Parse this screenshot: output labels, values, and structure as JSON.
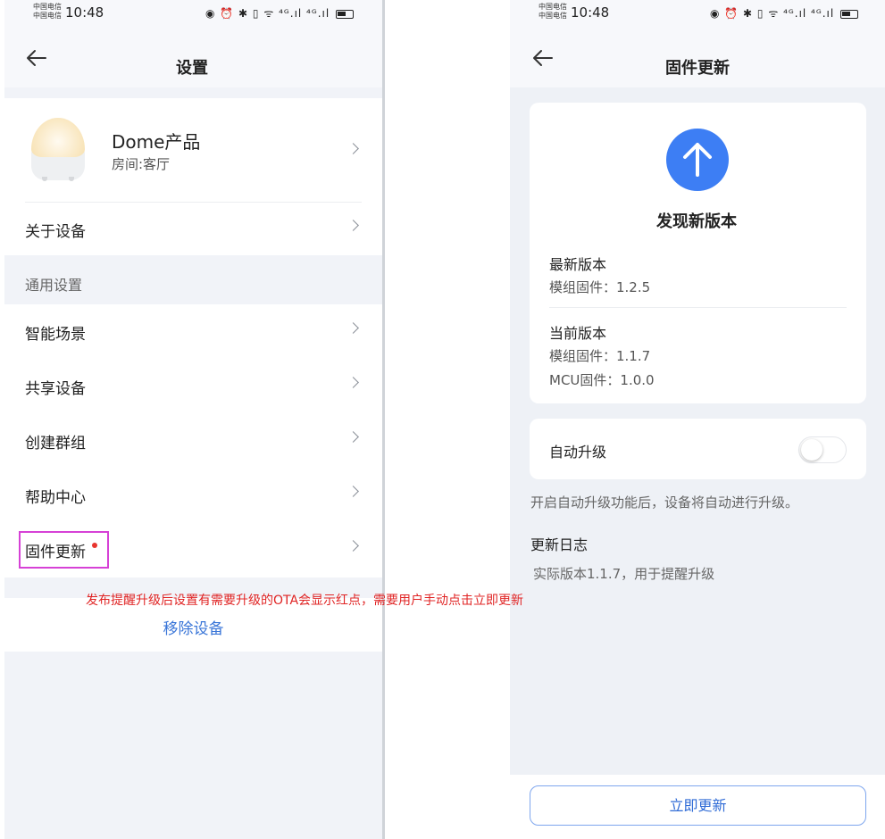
{
  "left": {
    "status": {
      "carrier1": "中国电信",
      "carrier2": "中国电信",
      "time": "10:48",
      "icons": "◉ ⏰ ✱ ▯ ᯤ ⁴ᴳ.ıl ⁴ᴳ.ıl"
    },
    "title": "设置",
    "device": {
      "name": "Dome产品",
      "room": "房间:客厅"
    },
    "about_label": "关于设备",
    "section_general": "通用设置",
    "items": [
      {
        "label": "智能场景"
      },
      {
        "label": "共享设备"
      },
      {
        "label": "创建群组"
      },
      {
        "label": "帮助中心"
      },
      {
        "label": "固件更新"
      }
    ],
    "remove_label": "移除设备",
    "annotation": "发布提醒升级后设置有需要升级的OTA会显示红点，需要用户手动点击立即更新",
    "accent": "#3a76d8",
    "highlight_color": "#d641d6",
    "annotation_color": "#e02424"
  },
  "right": {
    "status": {
      "carrier1": "中国电信",
      "carrier2": "中国电信",
      "time": "10:48",
      "icons": "◉ ⏰ ✱ ▯ ᯤ ⁴ᴳ.ıl ⁴ᴳ.ıl"
    },
    "title": "固件更新",
    "found_new": "发现新版本",
    "latest_heading": "最新版本",
    "latest_module": "模组固件：1.2.5",
    "current_heading": "当前版本",
    "current_module": "模组固件：1.1.7",
    "current_mcu": "MCU固件：1.0.0",
    "auto_upgrade_label": "自动升级",
    "auto_upgrade_on": false,
    "auto_upgrade_hint": "开启自动升级功能后，设备将自动进行升级。",
    "changelog_heading": "更新日志",
    "changelog_text": "实际版本1.1.7，用于提醒升级",
    "update_button": "立即更新",
    "accent": "#3d7ef4"
  }
}
